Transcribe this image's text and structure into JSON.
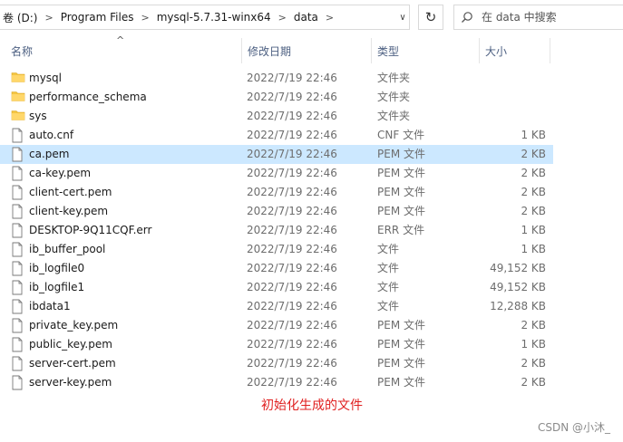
{
  "address": {
    "crumbs": [
      "卷 (D:)",
      "Program Files",
      "mysql-5.7.31-winx64",
      "data"
    ],
    "search_placeholder": "在 data 中搜索"
  },
  "columns": {
    "name": "名称",
    "date": "修改日期",
    "type": "类型",
    "size": "大小"
  },
  "files": [
    {
      "name": "mysql",
      "date": "2022/7/19 22:46",
      "type": "文件夹",
      "size": "",
      "icon": "folder-icon"
    },
    {
      "name": "performance_schema",
      "date": "2022/7/19 22:46",
      "type": "文件夹",
      "size": "",
      "icon": "folder-icon"
    },
    {
      "name": "sys",
      "date": "2022/7/19 22:46",
      "type": "文件夹",
      "size": "",
      "icon": "folder-icon"
    },
    {
      "name": "auto.cnf",
      "date": "2022/7/19 22:46",
      "type": "CNF 文件",
      "size": "1 KB",
      "icon": "file-icon"
    },
    {
      "name": "ca.pem",
      "date": "2022/7/19 22:46",
      "type": "PEM 文件",
      "size": "2 KB",
      "icon": "file-icon",
      "selected": true
    },
    {
      "name": "ca-key.pem",
      "date": "2022/7/19 22:46",
      "type": "PEM 文件",
      "size": "2 KB",
      "icon": "file-icon"
    },
    {
      "name": "client-cert.pem",
      "date": "2022/7/19 22:46",
      "type": "PEM 文件",
      "size": "2 KB",
      "icon": "file-icon"
    },
    {
      "name": "client-key.pem",
      "date": "2022/7/19 22:46",
      "type": "PEM 文件",
      "size": "2 KB",
      "icon": "file-icon"
    },
    {
      "name": "DESKTOP-9Q11CQF.err",
      "date": "2022/7/19 22:46",
      "type": "ERR 文件",
      "size": "1 KB",
      "icon": "file-icon"
    },
    {
      "name": "ib_buffer_pool",
      "date": "2022/7/19 22:46",
      "type": "文件",
      "size": "1 KB",
      "icon": "file-icon"
    },
    {
      "name": "ib_logfile0",
      "date": "2022/7/19 22:46",
      "type": "文件",
      "size": "49,152 KB",
      "icon": "file-icon"
    },
    {
      "name": "ib_logfile1",
      "date": "2022/7/19 22:46",
      "type": "文件",
      "size": "49,152 KB",
      "icon": "file-icon"
    },
    {
      "name": "ibdata1",
      "date": "2022/7/19 22:46",
      "type": "文件",
      "size": "12,288 KB",
      "icon": "file-icon"
    },
    {
      "name": "private_key.pem",
      "date": "2022/7/19 22:46",
      "type": "PEM 文件",
      "size": "2 KB",
      "icon": "file-icon"
    },
    {
      "name": "public_key.pem",
      "date": "2022/7/19 22:46",
      "type": "PEM 文件",
      "size": "1 KB",
      "icon": "file-icon"
    },
    {
      "name": "server-cert.pem",
      "date": "2022/7/19 22:46",
      "type": "PEM 文件",
      "size": "2 KB",
      "icon": "file-icon"
    },
    {
      "name": "server-key.pem",
      "date": "2022/7/19 22:46",
      "type": "PEM 文件",
      "size": "2 KB",
      "icon": "file-icon"
    }
  ],
  "caption": "初始化生成的文件",
  "watermark": "CSDN @小沐_",
  "colors": {
    "selected_row": "#cce8ff",
    "folder": "#f4c542",
    "caption": "#e02020",
    "header_text": "#4d6082"
  }
}
